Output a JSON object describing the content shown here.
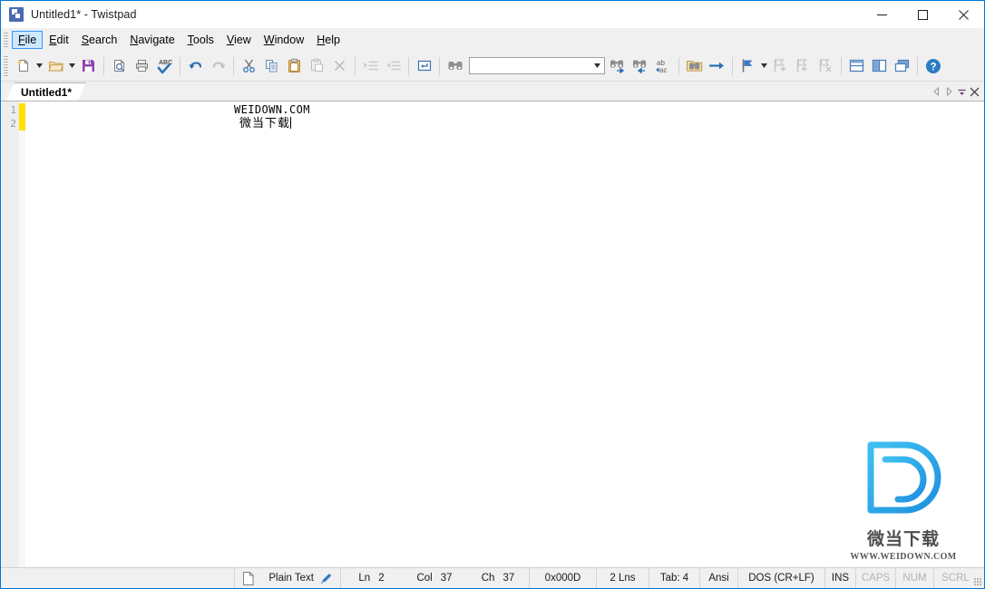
{
  "window": {
    "title": "Untitled1* - Twistpad",
    "app_icon": "twistpad-app-icon",
    "minimize": "minimize-icon",
    "maximize": "maximize-icon",
    "close": "close-icon",
    "border_color": "#0078d7"
  },
  "menubar": {
    "items": [
      {
        "label": "File",
        "mnemonic": "F",
        "active": true
      },
      {
        "label": "Edit",
        "mnemonic": "E",
        "active": false
      },
      {
        "label": "Search",
        "mnemonic": "S",
        "active": false
      },
      {
        "label": "Navigate",
        "mnemonic": "N",
        "active": false
      },
      {
        "label": "Tools",
        "mnemonic": "T",
        "active": false
      },
      {
        "label": "View",
        "mnemonic": "V",
        "active": false
      },
      {
        "label": "Window",
        "mnemonic": "W",
        "active": false
      },
      {
        "label": "Help",
        "mnemonic": "H",
        "active": false
      }
    ]
  },
  "toolbar": {
    "buttons": [
      {
        "name": "new-file-icon",
        "tip": "New"
      },
      {
        "name": "new-file-dropdown",
        "tip": "New options"
      },
      {
        "name": "open-file-icon",
        "tip": "Open"
      },
      {
        "name": "open-file-dropdown",
        "tip": "Open options"
      },
      {
        "name": "save-icon",
        "tip": "Save"
      },
      {
        "name": "print-preview-icon",
        "tip": "Print Preview"
      },
      {
        "name": "print-icon",
        "tip": "Print"
      },
      {
        "name": "spell-check-icon",
        "tip": "Spell Check"
      },
      {
        "name": "undo-icon",
        "tip": "Undo"
      },
      {
        "name": "redo-icon",
        "tip": "Redo"
      },
      {
        "name": "cut-icon",
        "tip": "Cut"
      },
      {
        "name": "copy-icon",
        "tip": "Copy"
      },
      {
        "name": "paste-icon",
        "tip": "Paste"
      },
      {
        "name": "paste-special-icon",
        "tip": "Paste Special"
      },
      {
        "name": "delete-icon",
        "tip": "Delete"
      },
      {
        "name": "indent-icon",
        "tip": "Indent"
      },
      {
        "name": "outdent-icon",
        "tip": "Outdent"
      },
      {
        "name": "insert-newline-icon",
        "tip": "Insert Line"
      },
      {
        "name": "find-icon",
        "tip": "Find"
      },
      {
        "name": "find-next-icon",
        "tip": "Find Next"
      },
      {
        "name": "find-previous-icon",
        "tip": "Find Previous"
      },
      {
        "name": "replace-icon",
        "tip": "Replace"
      },
      {
        "name": "find-in-files-icon",
        "tip": "Find in Files"
      },
      {
        "name": "goto-icon",
        "tip": "Go To"
      },
      {
        "name": "bookmark-toggle-icon",
        "tip": "Toggle Bookmark"
      },
      {
        "name": "bookmark-dropdown",
        "tip": "Bookmark options"
      },
      {
        "name": "bookmark-next-icon",
        "tip": "Next Bookmark"
      },
      {
        "name": "bookmark-prev-icon",
        "tip": "Previous Bookmark"
      },
      {
        "name": "bookmark-clear-icon",
        "tip": "Clear Bookmarks"
      },
      {
        "name": "split-horizontal-icon",
        "tip": "Tile Horizontally"
      },
      {
        "name": "split-vertical-icon",
        "tip": "Tile Vertically"
      },
      {
        "name": "cascade-windows-icon",
        "tip": "Cascade"
      },
      {
        "name": "help-icon",
        "tip": "Help"
      }
    ],
    "search": {
      "value": "",
      "placeholder": "",
      "dropdown": "chevron-down-icon"
    }
  },
  "tabs": {
    "items": [
      {
        "label": "Untitled1*",
        "active": true
      }
    ],
    "controls": [
      {
        "name": "tab-scroll-left-icon",
        "glyph": "◁"
      },
      {
        "name": "tab-scroll-right-icon",
        "glyph": "▷"
      },
      {
        "name": "tab-list-icon",
        "glyph": "▼"
      },
      {
        "name": "tab-close-icon",
        "glyph": "✕"
      }
    ]
  },
  "editor": {
    "gutter_numbers": [
      "1",
      "2"
    ],
    "lines": [
      {
        "number": "1",
        "text": "WEIDOWN.COM",
        "modified": true
      },
      {
        "number": "2",
        "text": "微当下载",
        "modified": true
      }
    ],
    "modified_marker_color": "#ffdf00",
    "caret_line": 2
  },
  "watermark": {
    "logo": "weidown-d-logo",
    "cn_text": "微当下载",
    "url_text": "WWW.WEIDOWN.COM",
    "accent": "#29a7e8"
  },
  "statusbar": {
    "doc_icon": "document-icon",
    "syntax": "Plain Text",
    "syntax_edit_icon": "pencil-icon",
    "ln_label": "Ln",
    "ln_value": "2",
    "col_label": "Col",
    "col_value": "37",
    "ch_label": "Ch",
    "ch_value": "37",
    "hex": "0x000D",
    "lines_total": "2 Lns",
    "tab_width": "Tab: 4",
    "encoding": "Ansi",
    "line_endings": "DOS (CR+LF)",
    "insert_mode": "INS",
    "caps": "CAPS",
    "num": "NUM",
    "scrl": "SCRL",
    "caps_active": false,
    "num_active": false,
    "scrl_active": false
  }
}
